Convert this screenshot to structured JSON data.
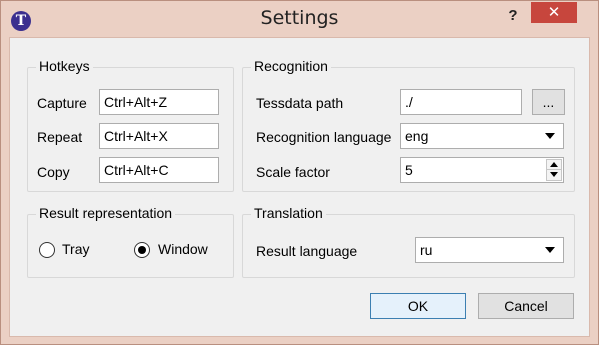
{
  "window": {
    "title": "Settings",
    "app_icon_glyph": "T",
    "help_glyph": "?",
    "close_glyph": "✕"
  },
  "hotkeys": {
    "title": "Hotkeys",
    "capture_label": "Capture",
    "capture_value": "Ctrl+Alt+Z",
    "repeat_label": "Repeat",
    "repeat_value": "Ctrl+Alt+X",
    "copy_label": "Copy",
    "copy_value": "Ctrl+Alt+C"
  },
  "recognition": {
    "title": "Recognition",
    "tessdata_label": "Tessdata path",
    "tessdata_value": "./",
    "browse_label": "...",
    "language_label": "Recognition language",
    "language_value": "eng",
    "scale_label": "Scale factor",
    "scale_value": "5"
  },
  "result_representation": {
    "title": "Result representation",
    "options": [
      {
        "label": "Tray",
        "checked": false
      },
      {
        "label": "Window",
        "checked": true
      }
    ]
  },
  "translation": {
    "title": "Translation",
    "result_language_label": "Result language",
    "result_language_value": "ru"
  },
  "buttons": {
    "ok_label": "OK",
    "cancel_label": "Cancel"
  },
  "colors": {
    "titlebar": "#ebd0c4",
    "close_button": "#c7463d",
    "client_bg": "#f0f0f0",
    "default_button_border": "#3c7fb1"
  }
}
